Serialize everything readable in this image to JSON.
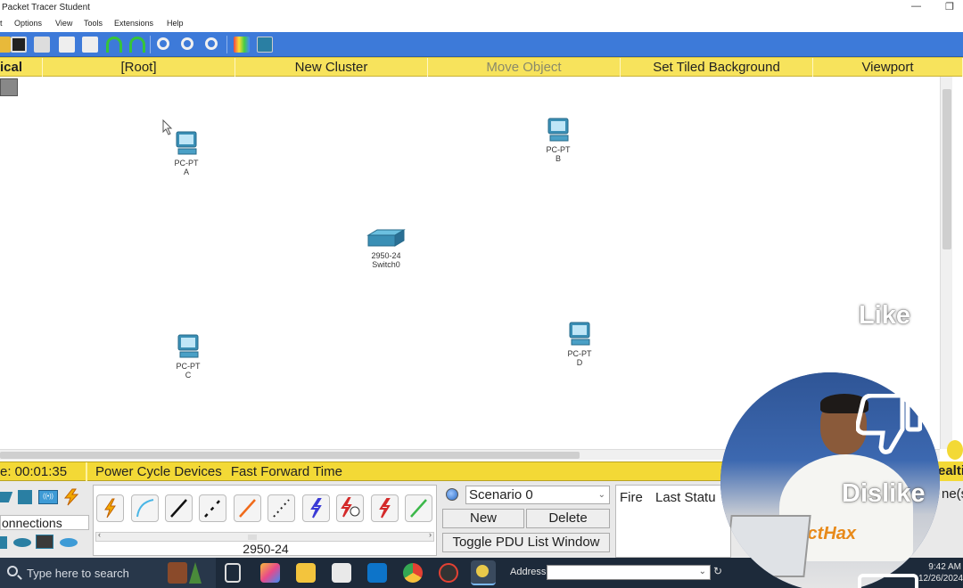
{
  "window": {
    "title": "Packet Tracer Student"
  },
  "menu": [
    "t",
    "Options",
    "View",
    "Tools",
    "Extensions",
    "Help"
  ],
  "nav": {
    "logical": "ical",
    "root": "[Root]",
    "new_cluster": "New Cluster",
    "move_object": "Move Object",
    "set_tiled_background": "Set Tiled Background",
    "viewport": "Viewport"
  },
  "devices": [
    {
      "model": "PC-PT",
      "name": "A"
    },
    {
      "model": "PC-PT",
      "name": "B"
    },
    {
      "model": "2950-24",
      "name": "Switch0"
    },
    {
      "model": "PC-PT",
      "name": "C"
    },
    {
      "model": "PC-PT",
      "name": "D"
    }
  ],
  "timebar": {
    "time": "e: 00:01:35",
    "power_cycle": "Power Cycle Devices",
    "fast_forward": "Fast Forward Time",
    "realtime": "ealti"
  },
  "bottom": {
    "connections_label": "onnections",
    "selected_device": "2950-24",
    "scenario_selected": "Scenario 0",
    "new_button": "New",
    "delete_button": "Delete",
    "toggle_pdu": "Toggle PDU List Window",
    "pdu_col_fire": "Fire",
    "pdu_col_last_status": "Last Statu",
    "pdu_col_source": "ne(s"
  },
  "taskbar": {
    "search_placeholder": "Type here to search",
    "address_label": "Address",
    "time": "9:42 AM",
    "date": "12/26/2024"
  },
  "overlays": {
    "like": "Like",
    "dislike": "Dislike",
    "watermark": "ictHax"
  },
  "colors": {
    "toolbar_blue": "#3d7ad9",
    "nav_yellow": "#f7e35c",
    "device_teal": "#3a8fb5",
    "taskbar": "#1d2a3a"
  }
}
